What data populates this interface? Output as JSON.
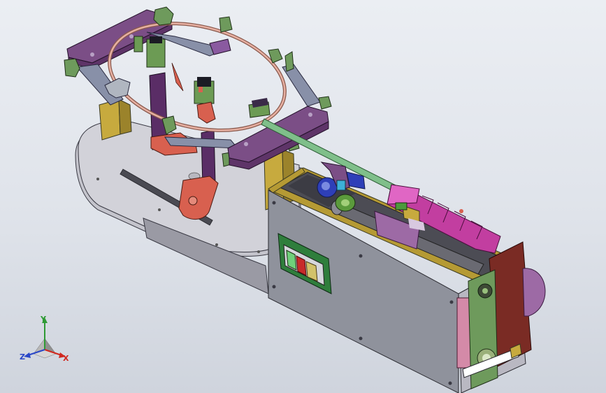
{
  "viewport": {
    "background_top": "#ebeef3",
    "background_bottom": "#cfd4dd"
  },
  "triad": {
    "x_label": "X",
    "y_label": "Y",
    "z_label": "Z",
    "x_color": "#d0281f",
    "y_color": "#2e9a34",
    "z_color": "#2a47c8"
  },
  "colors": {
    "base_plate": "#cfcfd6",
    "frame_arm": "#7b4e86",
    "housing_panel": "#8f929c",
    "hoop_ring": "#d49a8c",
    "bracket_green": "#6e9a5c",
    "pad_magenta": "#c23ea0",
    "mount_red": "#d8604f",
    "post_yellow": "#b59a34",
    "end_plate_red": "#7a2b24",
    "roller_purple": "#9d6aa5"
  },
  "switch_panel": {
    "buttons": [
      "green-button",
      "red-button",
      "yellow-button"
    ]
  }
}
